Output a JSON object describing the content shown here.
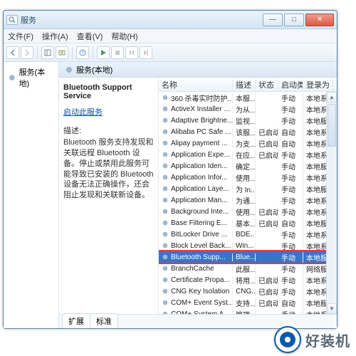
{
  "window": {
    "title": "服务"
  },
  "menu": {
    "file": "文件(F)",
    "action": "操作(A)",
    "view": "查看(V)",
    "help": "帮助(H)"
  },
  "tree": {
    "root": "服务(本地)"
  },
  "main_header": "服务(本地)",
  "detail": {
    "service_name": "Bluetooth Support Service",
    "start_link": "启动此服务",
    "desc_label": "描述:",
    "desc_text": "Bluetooth 服务支持发现和关联远程 Bluetooth 设备。停止或禁用此服务可能导致已安装的 Bluetooth 设备无法正确操作，还会阻止发现和关联新设备。"
  },
  "columns": {
    "name": "名称",
    "desc": "描述",
    "status": "状态",
    "startup": "启动类型",
    "logon": "登录为"
  },
  "rows": [
    {
      "name": "360 杀毒实时防护...",
      "desc": "本服...",
      "status": "",
      "startup": "手动",
      "logon": "本地系统"
    },
    {
      "name": "ActiveX Installer ...",
      "desc": "为从...",
      "status": "",
      "startup": "手动",
      "logon": "本地系统"
    },
    {
      "name": "Adaptive Brightne...",
      "desc": "监视...",
      "status": "",
      "startup": "手动",
      "logon": "本地服务"
    },
    {
      "name": "Alibaba PC Safe ...",
      "desc": "该服...",
      "status": "已启动",
      "startup": "自动",
      "logon": "本地系统"
    },
    {
      "name": "Alipay payment ...",
      "desc": "为支...",
      "status": "已启动",
      "startup": "自动",
      "logon": "本地系统"
    },
    {
      "name": "Application Expe...",
      "desc": "在应...",
      "status": "已启动",
      "startup": "手动",
      "logon": "本地系统"
    },
    {
      "name": "Application Iden...",
      "desc": "确定...",
      "status": "",
      "startup": "手动",
      "logon": "本地服务"
    },
    {
      "name": "Application Infor...",
      "desc": "使用...",
      "status": "",
      "startup": "手动",
      "logon": "本地系统"
    },
    {
      "name": "Application Laye...",
      "desc": "为 In...",
      "status": "",
      "startup": "手动",
      "logon": "本地服务"
    },
    {
      "name": "Application Man...",
      "desc": "为通...",
      "status": "",
      "startup": "手动",
      "logon": "本地系统"
    },
    {
      "name": "Background Inte...",
      "desc": "使用...",
      "status": "已启动",
      "startup": "手动",
      "logon": "本地系统"
    },
    {
      "name": "Base Filtering E...",
      "desc": "基本...",
      "status": "已启动",
      "startup": "自动",
      "logon": "本地服务"
    },
    {
      "name": "BitLocker Drive ...",
      "desc": "BDE...",
      "status": "",
      "startup": "手动",
      "logon": "本地系统"
    },
    {
      "name": "Block Level Back...",
      "desc": "Win...",
      "status": "",
      "startup": "手动",
      "logon": "本地系统"
    },
    {
      "name": "Bluetooth Supp...",
      "desc": "Blue...",
      "status": "",
      "startup": "手动",
      "logon": "本地服务",
      "selected": true
    },
    {
      "name": "BranchCache",
      "desc": "此服...",
      "status": "",
      "startup": "手动",
      "logon": "网络服务"
    },
    {
      "name": "Certificate Propa...",
      "desc": "将用...",
      "status": "已启动",
      "startup": "手动",
      "logon": "本地系统"
    },
    {
      "name": "CNG Key Isolation",
      "desc": "CNG...",
      "status": "已启动",
      "startup": "手动",
      "logon": "本地系统"
    },
    {
      "name": "COM+ Event Syst...",
      "desc": "支持...",
      "status": "已启动",
      "startup": "自动",
      "logon": "本地服务"
    },
    {
      "name": "COM+ System A...",
      "desc": "管理...",
      "status": "",
      "startup": "手动",
      "logon": "本地系统"
    }
  ],
  "tabs": {
    "ext": "扩展",
    "std": "标准"
  },
  "watermark": "好装机"
}
